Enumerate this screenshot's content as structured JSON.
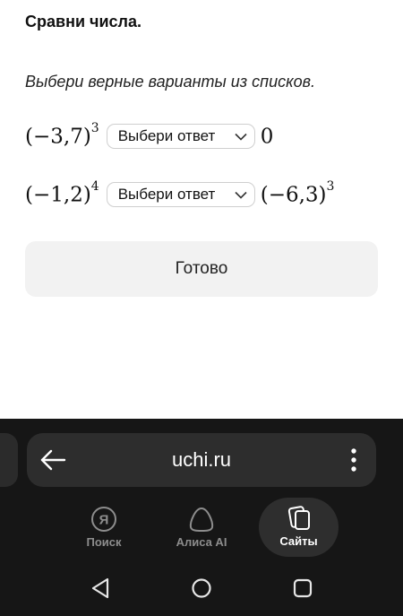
{
  "task": {
    "title": "Сравни числа.",
    "instruction": "Выбери верные варианты из списков."
  },
  "rows": [
    {
      "left": {
        "base": "(−3,7)",
        "exp": "3"
      },
      "select_label": "Выбери ответ",
      "right": {
        "base": "0",
        "exp": ""
      }
    },
    {
      "left": {
        "base": "(−1,2)",
        "exp": "4"
      },
      "select_label": "Выбери ответ",
      "right": {
        "base": "(−6,3)",
        "exp": "3"
      }
    }
  ],
  "done_label": "Готово",
  "browser": {
    "url": "uchi.ru",
    "nav": [
      {
        "label": "Поиск",
        "icon": "yandex-search-icon"
      },
      {
        "label": "Алиса AI",
        "icon": "alice-icon"
      },
      {
        "label": "Сайты",
        "icon": "sites-icon",
        "active": true
      }
    ]
  },
  "system_nav": [
    "back-icon",
    "home-icon",
    "recent-apps-icon"
  ],
  "colors": {
    "page_bg": "#ffffff",
    "done_button_bg": "#f2f2f2",
    "browser_bg": "#161616",
    "url_bar_bg": "#2d2d2d",
    "nav_inactive": "#8d8d8d",
    "nav_active": "#ffffff"
  }
}
